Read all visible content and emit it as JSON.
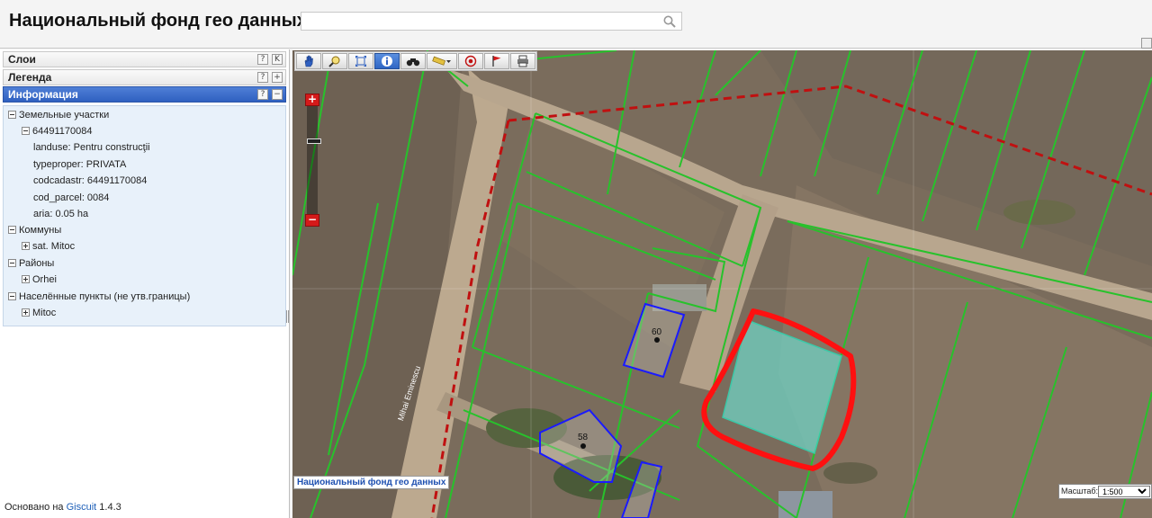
{
  "header": {
    "title": "Национальный фонд гео данных",
    "search_placeholder": "",
    "search_value": ""
  },
  "sidebar": {
    "panels": [
      {
        "label": "Слои",
        "help": "?",
        "action": "K"
      },
      {
        "label": "Легенда",
        "help": "?",
        "action": "+"
      },
      {
        "label": "Информация",
        "help": "?",
        "action": "−"
      }
    ],
    "info_tree": {
      "land_plots": "Земельные участки",
      "parcel_id": "64491170084",
      "attributes": [
        "landuse: Pentru construcţii",
        "typeproper: PRIVATA",
        "codcadastr: 64491170084",
        "cod_parcel: 0084",
        "aria: 0.05 ha"
      ],
      "communes": "Коммуны",
      "commune_item": "sat. Mitoc",
      "districts": "Районы",
      "district_item": "Orhei",
      "settlements": "Населённые пункты (не утв.границы)",
      "settlement_item": "Mitoc"
    },
    "footer": {
      "prefix": "Основано на ",
      "link": "Giscuit",
      "version": " 1.4.3"
    }
  },
  "map": {
    "tools": [
      "pan-icon",
      "identify-icon",
      "full-extent-icon",
      "info-icon",
      "find-icon",
      "measure-icon",
      "point-icon",
      "flag-icon",
      "print-icon"
    ],
    "zoom_in": "+",
    "zoom_out": "−",
    "credit": "Национальный фонд гео данных",
    "street_label": "Mihai Eminescu",
    "building_labels": [
      "60",
      "58"
    ],
    "scale_label": "Масштаб:",
    "scale_value": "1:500",
    "colors": {
      "parcel_lines": "#27c22b",
      "buildings": "#1a1aff",
      "selection": "#ff1010",
      "boundary": "#c01010",
      "highlight": "#6fd6c8"
    }
  }
}
